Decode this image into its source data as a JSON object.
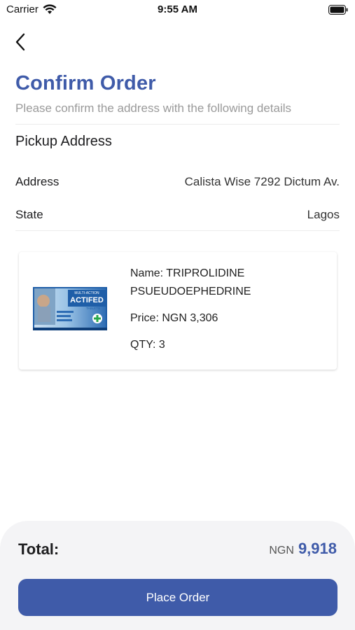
{
  "status_bar": {
    "carrier": "Carrier",
    "time": "9:55 AM",
    "wifi_icon": "wifi-icon",
    "battery_icon": "battery-icon"
  },
  "header": {
    "back_icon": "chevron-left-icon",
    "title": "Confirm Order",
    "subtitle": "Please confirm the address with the following details"
  },
  "pickup": {
    "section_title": "Pickup Address",
    "address_label": "Address",
    "address_value": "Calista Wise 7292 Dictum Av.",
    "state_label": "State",
    "state_value": "Lagos"
  },
  "product": {
    "name_line1": "Name: TRIPROLIDINE",
    "name_line2": "PSUEUDOEPHEDRINE",
    "price": "Price: NGN 3,306",
    "qty": "QTY: 3",
    "image": {
      "brand": "ACTIFED",
      "top_text": "MULTI-ACTION",
      "form": "TABLETS"
    }
  },
  "summary": {
    "total_label": "Total:",
    "currency": "NGN",
    "total_value": "9,918",
    "place_order_label": "Place Order"
  },
  "colors": {
    "accent": "#3f5ba9",
    "subtitle_gray": "#9a9a9a",
    "panel_bg": "#f4f4f6"
  }
}
